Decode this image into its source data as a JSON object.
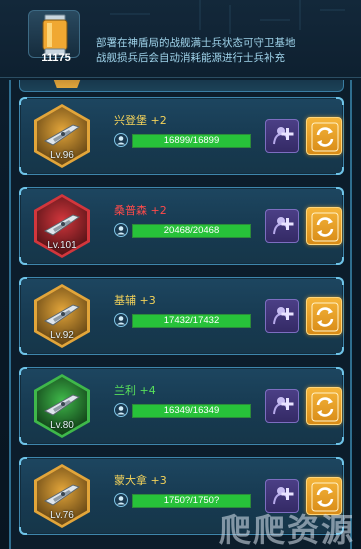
{
  "header": {
    "energy_value": "11175",
    "description_line1": "部署在神盾局的战舰满士兵状态可守卫基地",
    "description_line2": "战舰损兵后会自动消耗能源进行士兵补充",
    "icon": "energy-canister-icon"
  },
  "ships": [
    {
      "name": "兴登堡 +2",
      "level": "Lv.96",
      "hp": "16899/16899",
      "hp_fraction": 1.0,
      "name_color": "#f3d25a",
      "rarity_color": "#e2a53a",
      "rarity_dark": "#6b4a16"
    },
    {
      "name": "桑普森 +2",
      "level": "Lv.101",
      "hp": "20468/20468",
      "hp_fraction": 1.0,
      "name_color": "#ff4a4a",
      "rarity_color": "#d2363c",
      "rarity_dark": "#5a1418"
    },
    {
      "name": "基辅 +3",
      "level": "Lv.92",
      "hp": "17432/17432",
      "hp_fraction": 1.0,
      "name_color": "#f3d25a",
      "rarity_color": "#e2a53a",
      "rarity_dark": "#6b4a16"
    },
    {
      "name": "兰利 +4",
      "level": "Lv.80",
      "hp": "16349/16349",
      "hp_fraction": 1.0,
      "name_color": "#58e05a",
      "rarity_color": "#3fb84a",
      "rarity_dark": "#13451a"
    },
    {
      "name": "蒙大拿 +3",
      "level": "Lv.76",
      "hp": "1750?/1750?",
      "hp_fraction": 1.0,
      "name_color": "#f3d25a",
      "rarity_color": "#e2a53a",
      "rarity_dark": "#6b4a16"
    }
  ],
  "watermark": "爬爬资源",
  "icons": {
    "add": "add-troops-icon",
    "refresh": "refresh-icon",
    "troop": "troop-icon"
  }
}
